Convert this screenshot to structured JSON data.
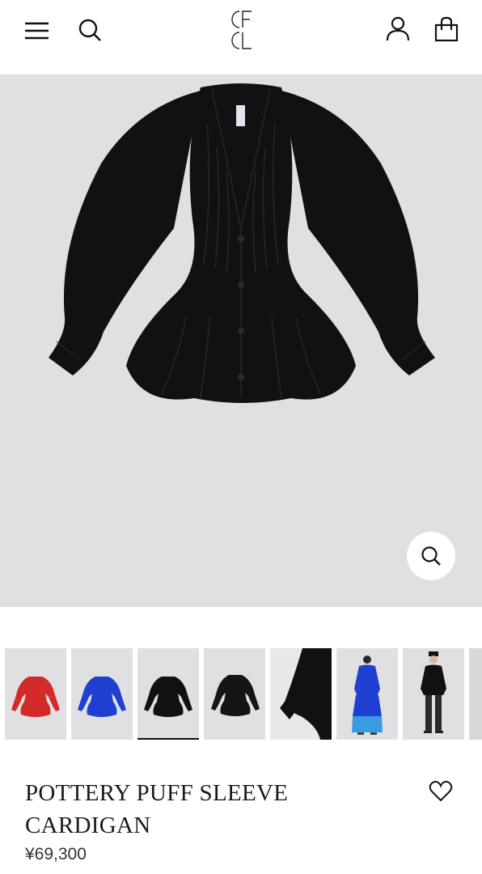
{
  "header": {
    "menu_icon": "hamburger-menu-icon",
    "search_icon": "search-icon",
    "logo_text": "CFCL",
    "account_icon": "user-account-icon",
    "bag_icon": "shopping-bag-icon"
  },
  "hero": {
    "background": "#e0dfe2",
    "garment_color": "#111111",
    "zoom_icon": "magnifier-icon"
  },
  "gallery": {
    "thumbnails": [
      {
        "label": "red cardigan",
        "color": "#d32a2a",
        "selected": false
      },
      {
        "label": "blue cardigan",
        "color": "#1f3fd0",
        "selected": false
      },
      {
        "label": "black cardigan front",
        "color": "#111111",
        "selected": true
      },
      {
        "label": "black cardigan angle",
        "color": "#111111",
        "selected": false
      },
      {
        "label": "sleeve detail",
        "color": "#111111",
        "selected": false
      },
      {
        "label": "model in blue",
        "color": "#1f3fd0",
        "selected": false
      },
      {
        "label": "model in black",
        "color": "#111111",
        "selected": false
      },
      {
        "label": "partial",
        "color": "#d8d8d8",
        "selected": false
      }
    ]
  },
  "product": {
    "title_line1": "POTTERY PUFF SLEEVE",
    "title_line2": "CARDIGAN",
    "price": "¥69,300",
    "wishlist_icon": "heart-icon"
  }
}
